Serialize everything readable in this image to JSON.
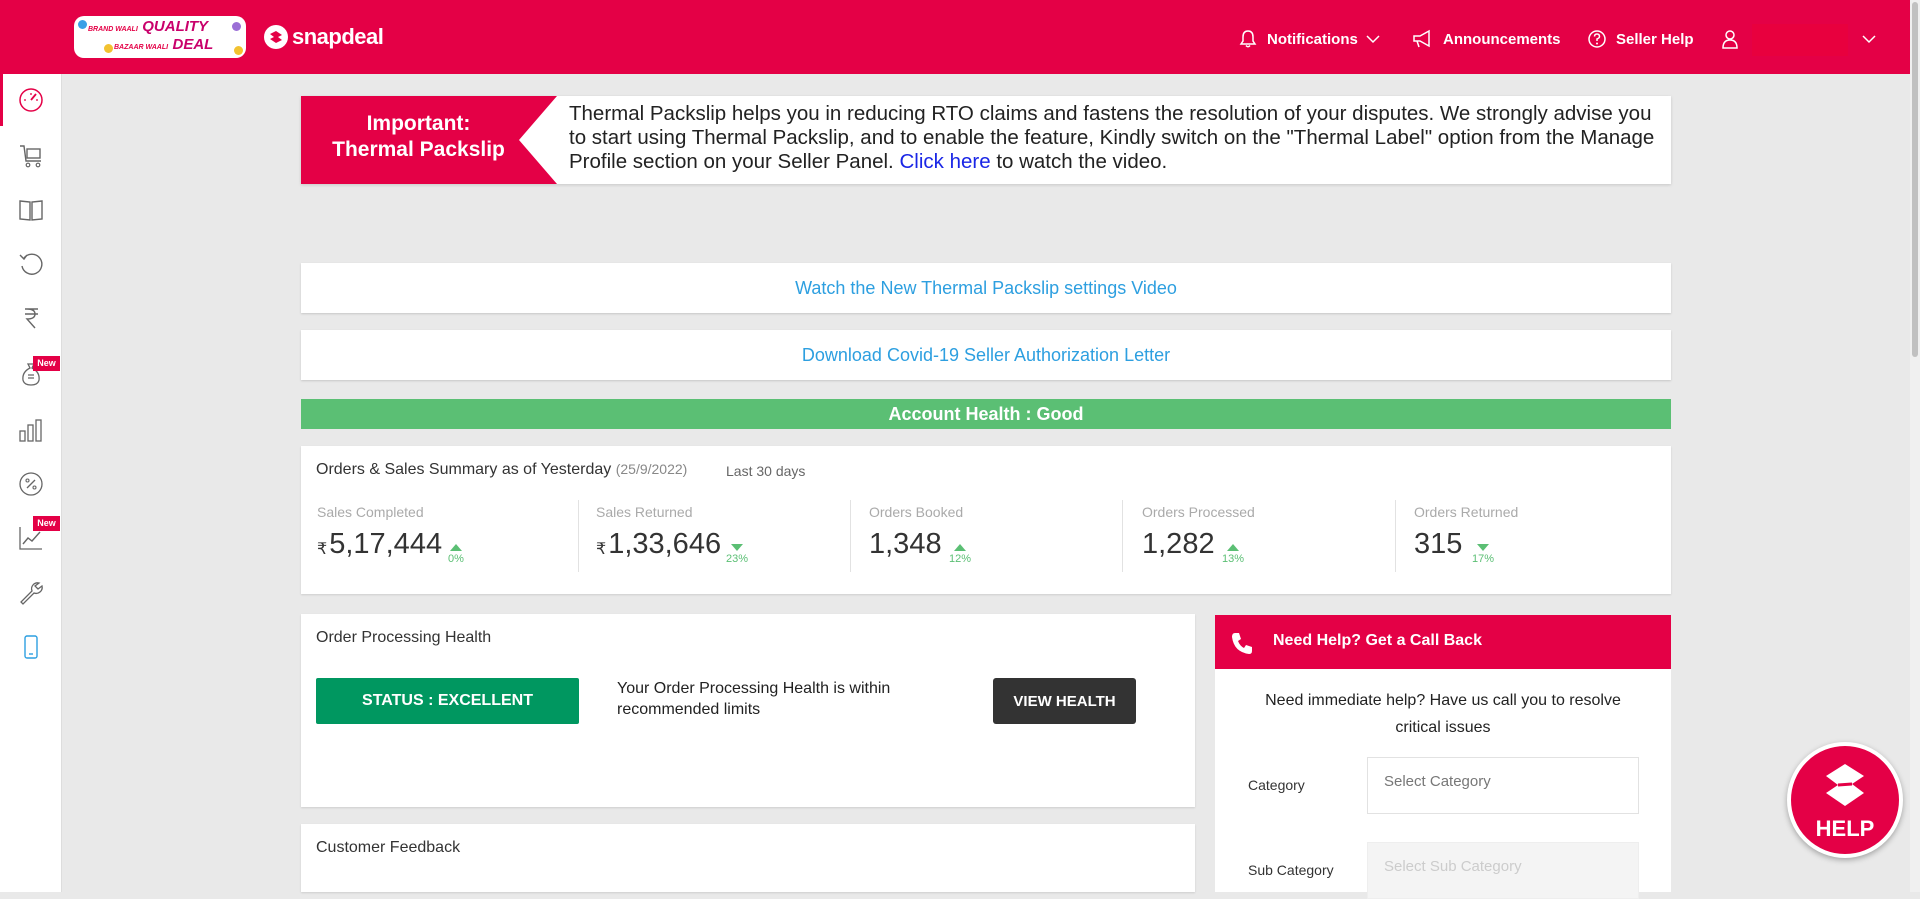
{
  "header": {
    "promo": {
      "line1_small": "BRAND WAALI",
      "line1_big": "QUALITY",
      "line2_small": "BAZAAR WAALI",
      "line2_big": "DEAL"
    },
    "logo_text": "snapdeal",
    "notifications_label": "Notifications",
    "announcements_label": "Announcements",
    "seller_help_label": "Seller Help"
  },
  "sidebar": {
    "items": [
      {
        "icon": "dashboard-gauge-icon",
        "active": true
      },
      {
        "icon": "cart-icon"
      },
      {
        "icon": "catalog-book-icon"
      },
      {
        "icon": "returns-icon"
      },
      {
        "icon": "rupee-icon"
      },
      {
        "icon": "money-bag-icon",
        "badge": "New"
      },
      {
        "icon": "bar-chart-icon"
      },
      {
        "icon": "percent-icon"
      },
      {
        "icon": "trend-chart-icon",
        "badge": "New"
      },
      {
        "icon": "wrench-icon"
      },
      {
        "icon": "mobile-icon"
      }
    ]
  },
  "banner": {
    "left_line1": "Important:",
    "left_line2": "Thermal Packslip",
    "text_before": "Thermal Packslip helps you in reducing RTO claims and fastens the resolution of your disputes. We strongly advise you to start using Thermal Packslip, and to enable the feature, Kindly switch on the \"Thermal Label\" option from the Manage Profile section on your Seller Panel.",
    "link_text": "Click here",
    "text_after": "to watch the video."
  },
  "links": {
    "video": "Watch the New Thermal Packslip settings Video",
    "covid": "Download Covid-19 Seller Authorization Letter"
  },
  "account_health": "Account Health : Good",
  "summary": {
    "title": "Orders & Sales Summary as of Yesterday",
    "date": "(25/9/2022)",
    "period": "Last 30 days",
    "currency_symbol": "₹",
    "metrics": [
      {
        "label": "Sales Completed",
        "value": "5,17,444",
        "change": "0%",
        "direction": "up",
        "currency": true
      },
      {
        "label": "Sales Returned",
        "value": "1,33,646",
        "change": "23%",
        "direction": "down",
        "currency": true
      },
      {
        "label": "Orders Booked",
        "value": "1,348",
        "change": "12%",
        "direction": "up",
        "currency": false
      },
      {
        "label": "Orders Processed",
        "value": "1,282",
        "change": "13%",
        "direction": "up",
        "currency": false
      },
      {
        "label": "Orders Returned",
        "value": "315",
        "change": "17%",
        "direction": "down",
        "currency": false
      }
    ]
  },
  "order_processing": {
    "title": "Order Processing Health",
    "status": "STATUS : EXCELLENT",
    "description": "Your Order Processing Health is within recommended limits",
    "view_button": "VIEW HEALTH"
  },
  "customer_feedback": {
    "title": "Customer Feedback"
  },
  "callback": {
    "title": "Need Help? Get a Call Back",
    "intro": "Need immediate help? Have us call you to resolve critical issues",
    "category_label": "Category",
    "category_placeholder": "Select Category",
    "subcategory_label": "Sub Category",
    "subcategory_placeholder": "Select Sub Category"
  },
  "help_bubble_label": "HELP",
  "colors": {
    "brand": "#e40046",
    "good": "#5bbf74",
    "excellent": "#009760",
    "link": "#2d9fe0"
  }
}
